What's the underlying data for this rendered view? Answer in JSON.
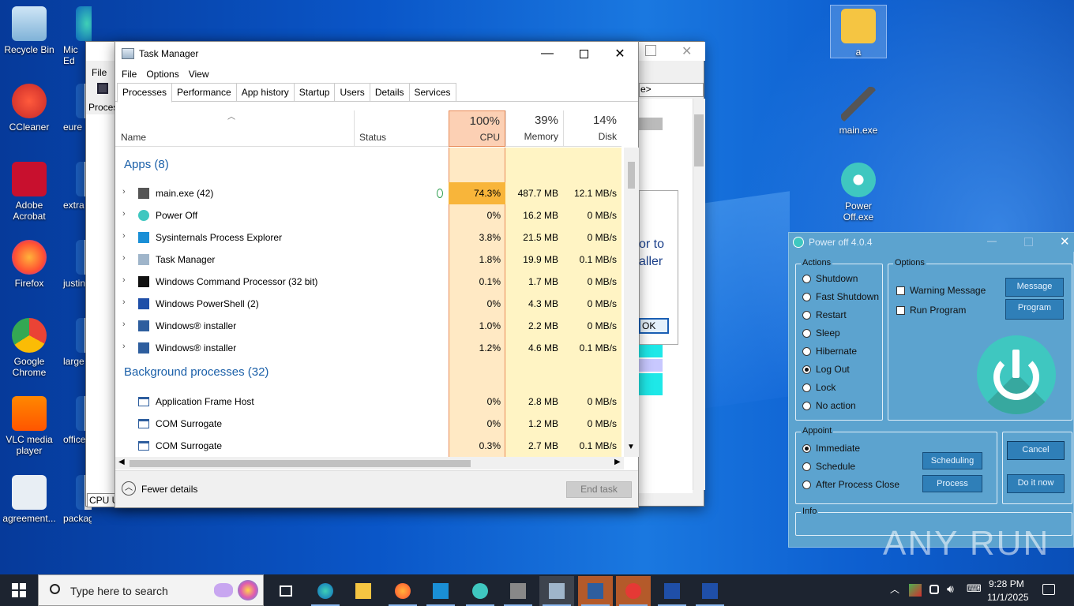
{
  "desktop": {
    "icons_left": [
      {
        "label": "Recycle Bin",
        "name": "recycle-bin-icon"
      },
      {
        "label": "CCleaner",
        "name": "ccleaner-icon"
      },
      {
        "label": "Adobe Acrobat",
        "name": "adobe-acrobat-icon"
      },
      {
        "label": "Firefox",
        "name": "firefox-icon"
      },
      {
        "label": "Google Chrome",
        "name": "chrome-icon"
      },
      {
        "label": "VLC media player",
        "name": "vlc-icon"
      },
      {
        "label": "agreement...",
        "name": "image-file-icon"
      }
    ],
    "icons_col2": [
      {
        "label": "Mic Ed",
        "name": "edge-icon"
      },
      {
        "label": "eure",
        "name": "word-file-icon"
      },
      {
        "label": "extra",
        "name": "word-file-icon"
      },
      {
        "label": "justin",
        "name": "word-file-icon"
      },
      {
        "label": "large",
        "name": "word-file-icon"
      },
      {
        "label": "office",
        "name": "word-file-icon"
      },
      {
        "label": "packageou...",
        "name": "word-file-icon"
      }
    ],
    "icons_right": [
      {
        "label": "a",
        "name": "folder-icon"
      },
      {
        "label": "main.exe",
        "name": "pickaxe-icon"
      },
      {
        "label": "Power Off.exe",
        "name": "power-icon"
      }
    ]
  },
  "background_window": {
    "menu_file": "File",
    "proc_label": "Proces",
    "cpu_label": "CPU U",
    "breadcrumb_tail": "e>",
    "dialog_text_1": "or to",
    "dialog_text_2": "aller",
    "ok_label": "OK"
  },
  "task_manager": {
    "title": "Task Manager",
    "menu": [
      "File",
      "Options",
      "View"
    ],
    "tabs": [
      "Processes",
      "Performance",
      "App history",
      "Startup",
      "Users",
      "Details",
      "Services"
    ],
    "columns": {
      "name": "Name",
      "status": "Status",
      "cpu_pct": "100%",
      "cpu": "CPU",
      "mem_pct": "39%",
      "mem": "Memory",
      "disk_pct": "14%",
      "disk": "Disk"
    },
    "apps_header": "Apps (8)",
    "apps": [
      {
        "name": "main.exe (42)",
        "cpu": "74.3%",
        "mem": "487.7 MB",
        "disk": "12.1 MB/s",
        "icon": "pickaxe-icon"
      },
      {
        "name": "Power Off",
        "cpu": "0%",
        "mem": "16.2 MB",
        "disk": "0 MB/s",
        "icon": "power-icon"
      },
      {
        "name": "Sysinternals Process Explorer",
        "cpu": "3.8%",
        "mem": "21.5 MB",
        "disk": "0 MB/s",
        "icon": "procexp-icon"
      },
      {
        "name": "Task Manager",
        "cpu": "1.8%",
        "mem": "19.9 MB",
        "disk": "0.1 MB/s",
        "icon": "taskmgr-icon"
      },
      {
        "name": "Windows Command Processor (32 bit)",
        "cpu": "0.1%",
        "mem": "1.7 MB",
        "disk": "0 MB/s",
        "icon": "cmd-icon"
      },
      {
        "name": "Windows PowerShell (2)",
        "cpu": "0%",
        "mem": "4.3 MB",
        "disk": "0 MB/s",
        "icon": "powershell-icon"
      },
      {
        "name": "Windows® installer",
        "cpu": "1.0%",
        "mem": "2.2 MB",
        "disk": "0 MB/s",
        "icon": "installer-icon"
      },
      {
        "name": "Windows® installer",
        "cpu": "1.2%",
        "mem": "4.6 MB",
        "disk": "0.1 MB/s",
        "icon": "installer-icon"
      }
    ],
    "bg_header": "Background processes (32)",
    "bg": [
      {
        "name": "Application Frame Host",
        "cpu": "0%",
        "mem": "2.8 MB",
        "disk": "0 MB/s"
      },
      {
        "name": "COM Surrogate",
        "cpu": "0%",
        "mem": "1.2 MB",
        "disk": "0 MB/s"
      },
      {
        "name": "COM Surrogate",
        "cpu": "0.3%",
        "mem": "2.7 MB",
        "disk": "0.1 MB/s"
      }
    ],
    "fewer_details": "Fewer details",
    "end_task": "End task"
  },
  "poweroff": {
    "title": "Power off 4.0.4",
    "actions_label": "Actions",
    "actions": [
      "Shutdown",
      "Fast Shutdown",
      "Restart",
      "Sleep",
      "Hibernate",
      "Log Out",
      "Lock",
      "No action"
    ],
    "actions_selected": 5,
    "options_label": "Options",
    "opt_warning": "Warning Message",
    "opt_run": "Run Program",
    "btn_message": "Message",
    "btn_program": "Program",
    "appoint_label": "Appoint",
    "appoint": [
      "Immediate",
      "Schedule",
      "After Process Close"
    ],
    "appoint_selected": 0,
    "btn_scheduling": "Scheduling",
    "btn_process": "Process",
    "btn_cancel": "Cancel",
    "btn_doit": "Do it now",
    "info_label": "Info"
  },
  "watermark": "ANY RUN",
  "taskbar": {
    "search_placeholder": "Type here to search",
    "time": "9:28 PM",
    "date": "11/1/2025"
  }
}
